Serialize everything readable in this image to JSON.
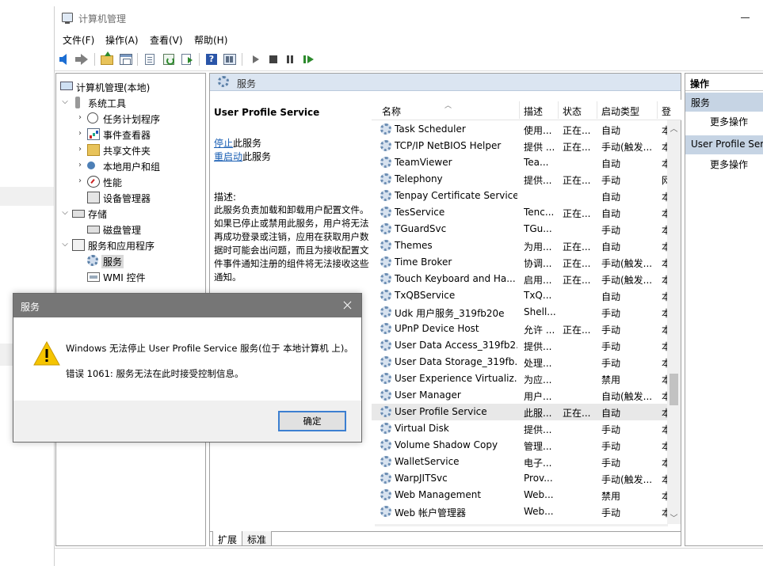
{
  "window": {
    "title": "计算机管理"
  },
  "menu": {
    "file": "文件(F)",
    "action": "操作(A)",
    "view": "查看(V)",
    "help": "帮助(H)"
  },
  "toolbar_icons": [
    "back-icon",
    "forward-icon",
    "up-folder-icon",
    "show-tree-icon",
    "properties-icon",
    "refresh-icon",
    "export-icon",
    "help-icon",
    "view-icon",
    "start-icon",
    "stop-icon",
    "pause-icon",
    "restart-icon"
  ],
  "tree": {
    "root": "计算机管理(本地)",
    "system_tools": "系统工具",
    "task_scheduler": "任务计划程序",
    "event_viewer": "事件查看器",
    "shared_folders": "共享文件夹",
    "local_users": "本地用户和组",
    "performance": "性能",
    "device_manager": "设备管理器",
    "storage": "存储",
    "disk_management": "磁盘管理",
    "services_apps": "服务和应用程序",
    "services": "服务",
    "wmi": "WMI 控件"
  },
  "center": {
    "header": "服务",
    "service_name": "User Profile Service",
    "stop_link": "停止",
    "stop_suffix": "此服务",
    "restart_link": "重启动",
    "restart_suffix": "此服务",
    "desc_label": "描述:",
    "desc_text": "此服务负责加载和卸载用户配置文件。如果已停止或禁用此服务，用户将无法再成功登录或注销，应用在获取用户数据时可能会出问题，而且为接收配置文件事件通知注册的组件将无法接收这些通知。"
  },
  "columns": {
    "name": "名称",
    "description": "描述",
    "status": "状态",
    "startup": "启动类型",
    "logon": "登"
  },
  "services": [
    {
      "name": "Task Scheduler",
      "desc": "使用...",
      "status": "正在...",
      "startup": "自动",
      "logon": "本"
    },
    {
      "name": "TCP/IP NetBIOS Helper",
      "desc": "提供 ...",
      "status": "正在...",
      "startup": "手动(触发...",
      "logon": "本"
    },
    {
      "name": "TeamViewer",
      "desc": "Tea...",
      "status": "",
      "startup": "自动",
      "logon": "本"
    },
    {
      "name": "Telephony",
      "desc": "提供...",
      "status": "正在...",
      "startup": "手动",
      "logon": "网"
    },
    {
      "name": "Tenpay Certificate Service",
      "desc": "",
      "status": "",
      "startup": "自动",
      "logon": "本"
    },
    {
      "name": "TesService",
      "desc": "Tenc...",
      "status": "正在...",
      "startup": "自动",
      "logon": "本"
    },
    {
      "name": "TGuardSvc",
      "desc": "TGu...",
      "status": "",
      "startup": "手动",
      "logon": "本"
    },
    {
      "name": "Themes",
      "desc": "为用...",
      "status": "正在...",
      "startup": "自动",
      "logon": "本"
    },
    {
      "name": "Time Broker",
      "desc": "协调...",
      "status": "正在...",
      "startup": "手动(触发...",
      "logon": "本"
    },
    {
      "name": "Touch Keyboard and Ha...",
      "desc": "启用...",
      "status": "正在...",
      "startup": "手动(触发...",
      "logon": "本"
    },
    {
      "name": "TxQBService",
      "desc": "TxQ...",
      "status": "",
      "startup": "自动",
      "logon": "本"
    },
    {
      "name": "Udk 用户服务_319fb20e",
      "desc": "Shell...",
      "status": "",
      "startup": "手动",
      "logon": "本"
    },
    {
      "name": "UPnP Device Host",
      "desc": "允许 ...",
      "status": "正在...",
      "startup": "手动",
      "logon": "本"
    },
    {
      "name": "User Data Access_319fb2...",
      "desc": "提供...",
      "status": "",
      "startup": "手动",
      "logon": "本"
    },
    {
      "name": "User Data Storage_319fb...",
      "desc": "处理...",
      "status": "",
      "startup": "手动",
      "logon": "本"
    },
    {
      "name": "User Experience Virtualiz...",
      "desc": "为应...",
      "status": "",
      "startup": "禁用",
      "logon": "本"
    },
    {
      "name": "User Manager",
      "desc": "用户...",
      "status": "",
      "startup": "自动(触发...",
      "logon": "本"
    },
    {
      "name": "User Profile Service",
      "desc": "此服...",
      "status": "正在...",
      "startup": "自动",
      "logon": "本"
    },
    {
      "name": "Virtual Disk",
      "desc": "提供...",
      "status": "",
      "startup": "手动",
      "logon": "本"
    },
    {
      "name": "Volume Shadow Copy",
      "desc": "管理...",
      "status": "",
      "startup": "手动",
      "logon": "本"
    },
    {
      "name": "WalletService",
      "desc": "电子...",
      "status": "",
      "startup": "手动",
      "logon": "本"
    },
    {
      "name": "WarpJITSvc",
      "desc": "Prov...",
      "status": "",
      "startup": "手动(触发...",
      "logon": "本"
    },
    {
      "name": "Web Management",
      "desc": "Web...",
      "status": "",
      "startup": "禁用",
      "logon": "本"
    },
    {
      "name": "Web 帐户管理器",
      "desc": "Web...",
      "status": "",
      "startup": "手动",
      "logon": "本"
    }
  ],
  "selected_service_index": 17,
  "tabs": {
    "extended": "扩展",
    "standard": "标准"
  },
  "actions": {
    "header": "操作",
    "section1": "服务",
    "more1": "更多操作",
    "section2": "User Profile Service",
    "more2": "更多操作"
  },
  "dialog": {
    "title": "服务",
    "message": "Windows 无法停止 User Profile Service 服务(位于 本地计算机 上)。",
    "error": "错误 1061: 服务无法在此时接受控制信息。",
    "ok": "确定"
  },
  "colors": {
    "dialog_title_bg": "#767676",
    "ok_border": "#3c7fd1",
    "action_section_bg": "#c6d4e4",
    "pane_header_bg": "#dbe5f1",
    "link": "#1a5fb4"
  }
}
